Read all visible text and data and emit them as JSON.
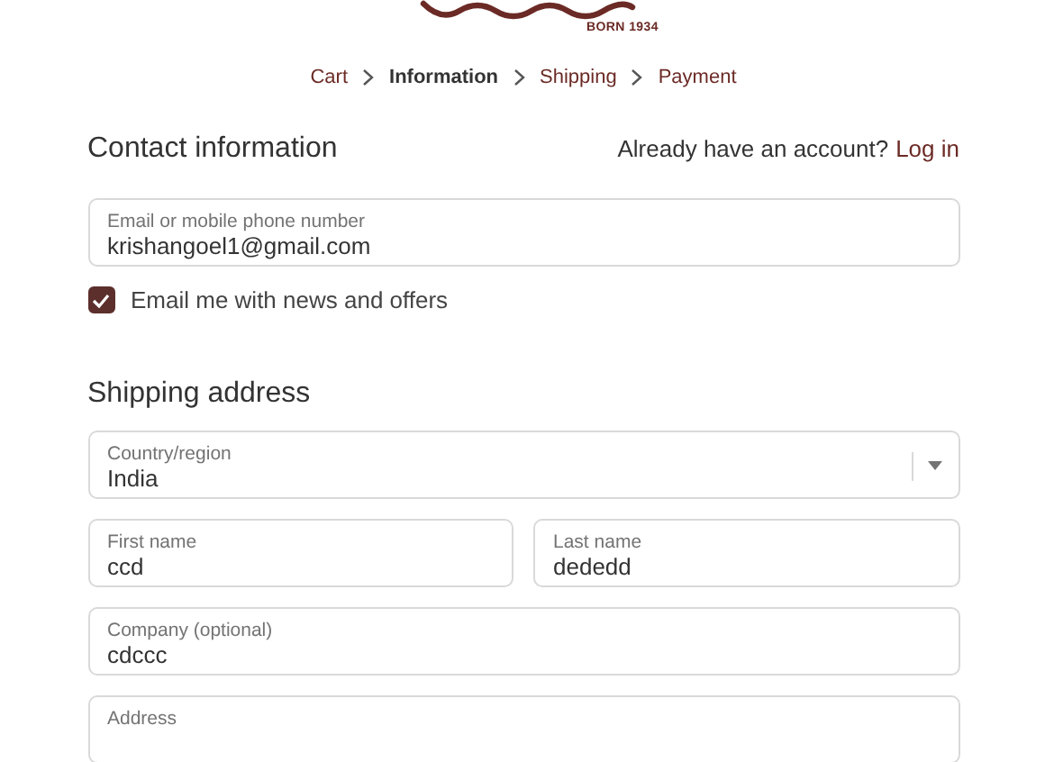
{
  "header": {
    "tagline": "BORN 1934"
  },
  "breadcrumb": [
    {
      "label": "Cart",
      "selected": false
    },
    {
      "label": "Information",
      "selected": true
    },
    {
      "label": "Shipping",
      "selected": false
    },
    {
      "label": "Payment",
      "selected": false
    }
  ],
  "contact": {
    "title": "Contact information",
    "account_prompt": "Already have an account?",
    "login_link": "Log in",
    "email": {
      "label": "Email or mobile phone number",
      "value": "krishangoel1@gmail.com"
    },
    "newsletter": {
      "label": "Email me with news and offers",
      "checked": true
    }
  },
  "shipping": {
    "title": "Shipping address",
    "rows": [
      [
        {
          "kind": "select",
          "label": "Country/region",
          "value": "India"
        }
      ],
      [
        {
          "kind": "text",
          "label": "First name",
          "value": "ccd"
        },
        {
          "kind": "text",
          "label": "Last name",
          "value": "dededd"
        }
      ],
      [
        {
          "kind": "text",
          "label": "Company (optional)",
          "value": "cdccc"
        }
      ],
      [
        {
          "kind": "text",
          "label": "Address"
        }
      ]
    ]
  }
}
